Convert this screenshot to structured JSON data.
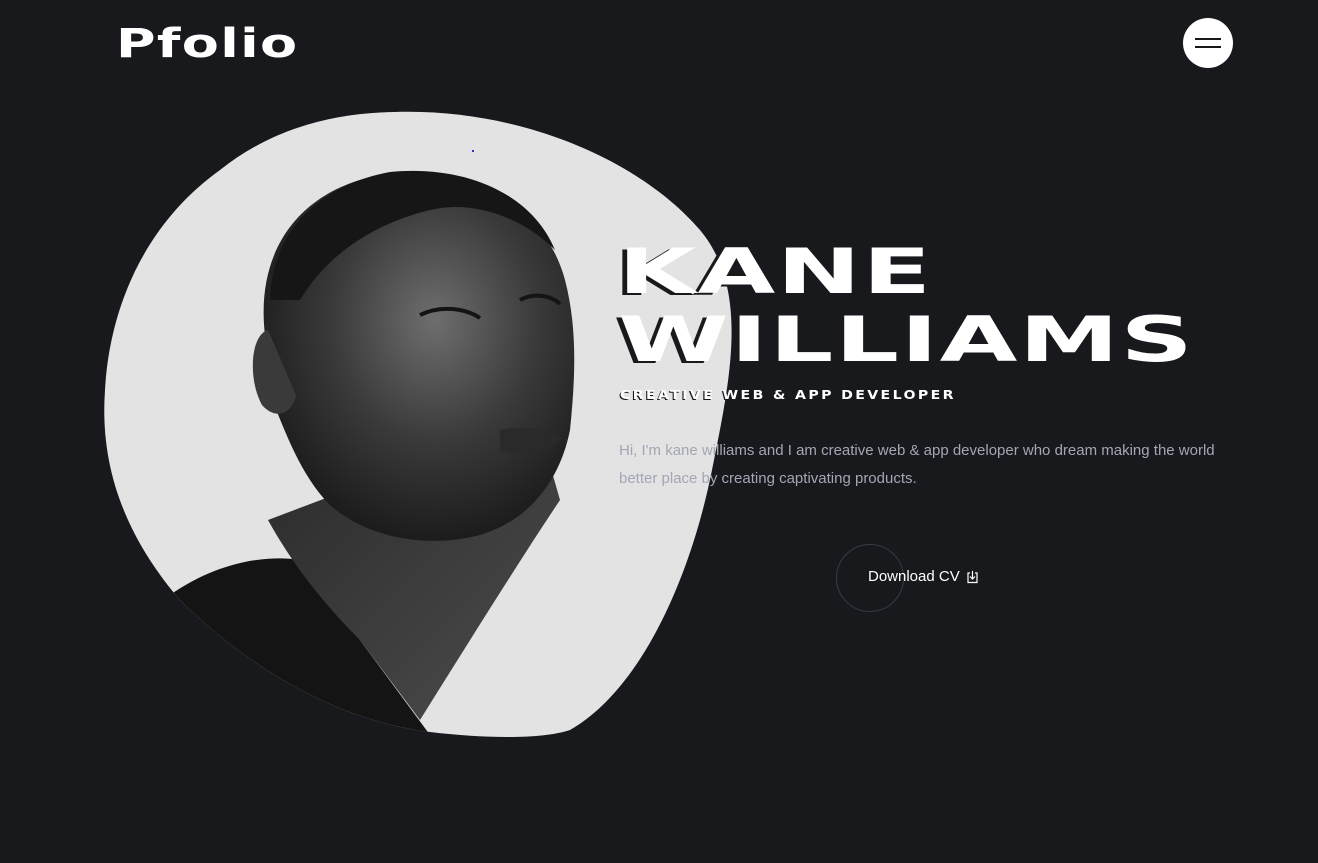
{
  "header": {
    "logo_text": "Pfolio",
    "menu_icon": "hamburger-menu-icon"
  },
  "hero": {
    "name_line1": "KANE",
    "name_line2": "WILLIAMS",
    "subtitle": "CREATIVE WEB & APP DEVELOPER",
    "bio": "Hi, I'm kane williams and I am creative web & app developer who dream making the world better place by creating captivating products.",
    "cta_label": "Download CV",
    "cta_icon": "download-icon"
  },
  "colors": {
    "background": "#18191d",
    "blob": "#e3e3e3",
    "text_primary": "#ffffff",
    "text_muted": "#a3a6b4"
  }
}
